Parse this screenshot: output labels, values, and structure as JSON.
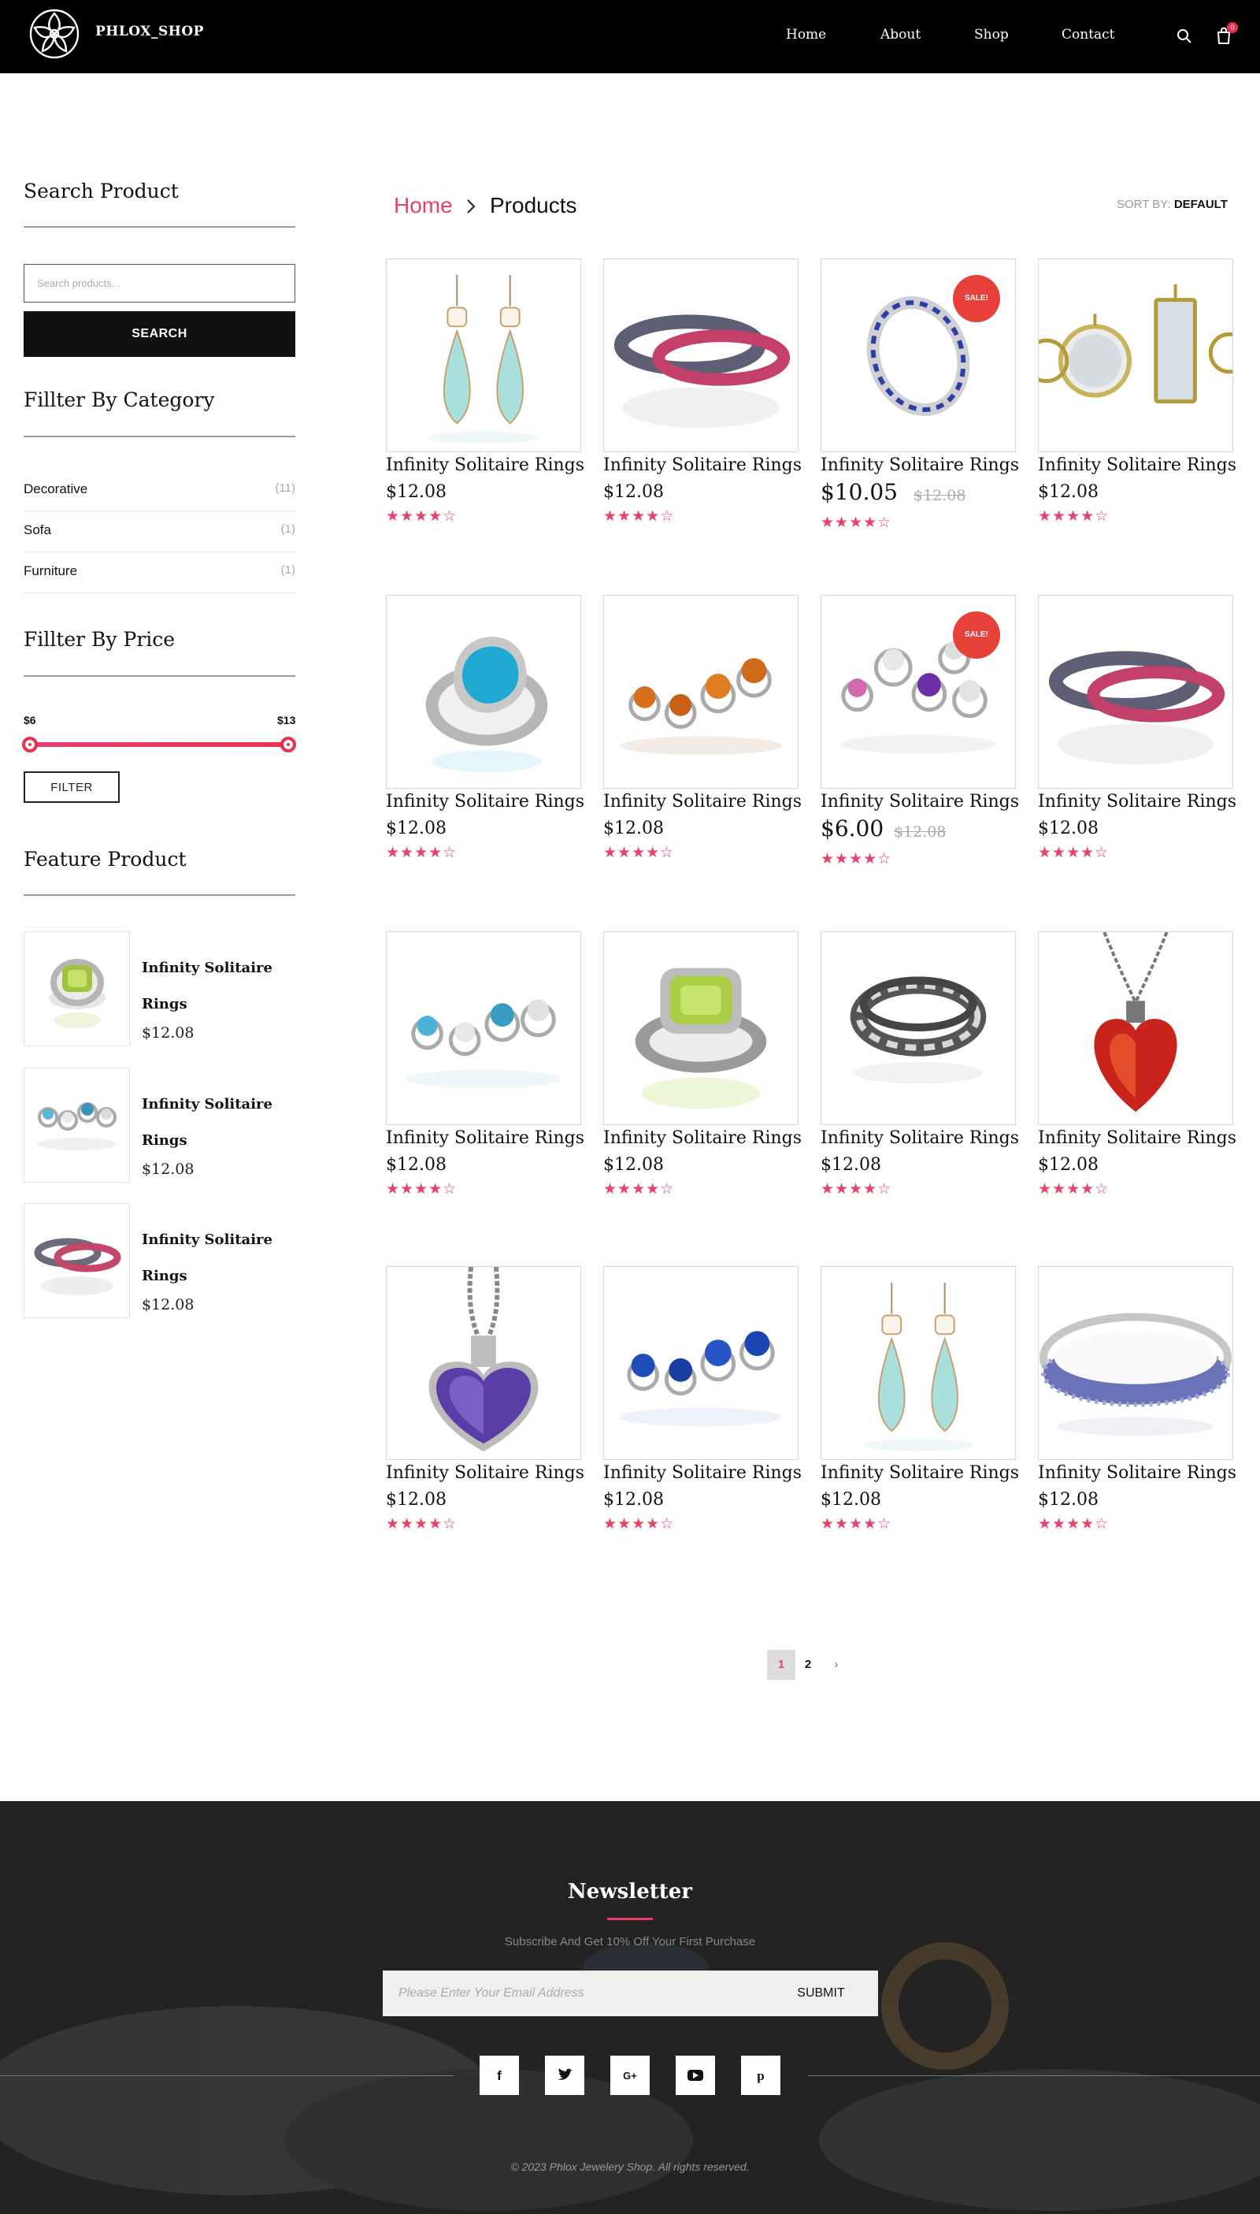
{
  "header": {
    "brand": "PHLOX_SHOP",
    "nav": [
      "Home",
      "About",
      "Shop",
      "Contact"
    ],
    "cart_count": "0",
    "icons": [
      "logo-flower-icon",
      "search-icon",
      "cart-icon"
    ]
  },
  "sidebar": {
    "search_title": "Search Product",
    "search_placeholder": "Search products...",
    "search_button": "SEARCH",
    "category_title": "Fillter By Category",
    "categories": [
      {
        "name": "Decorative",
        "count": "(11)"
      },
      {
        "name": "Sofa",
        "count": "(1)"
      },
      {
        "name": "Furniture",
        "count": "(1)"
      }
    ],
    "price_title": "Fillter By Price",
    "price_min": "$6",
    "price_max": "$13",
    "range_selected": [
      0,
      1
    ],
    "filter_button": "FILTER",
    "feature_title": "Feature Product",
    "features": [
      {
        "name": "Infinity Solitaire Rings",
        "price": "$12.08"
      },
      {
        "name": "Infinity Solitaire Rings",
        "price": "$12.08"
      },
      {
        "name": "Infinity Solitaire Rings",
        "price": "$12.08"
      }
    ]
  },
  "main": {
    "breadcrumb_home": "Home",
    "breadcrumb_current": "Products",
    "sort_label": "SORT BY:",
    "sort_value": "DEFAULT",
    "stars": "★★★★☆",
    "products": [
      {
        "name": "Infinity Solitaire Rings",
        "price": "$12.08",
        "image": "earrings"
      },
      {
        "name": "Infinity Solitaire Rings",
        "price": "$12.08",
        "image": "band-rings"
      },
      {
        "name": "Infinity Solitaire Rings",
        "price": "$10.05",
        "old_price": "$12.08",
        "sale": "SALE!",
        "image": "sapphire-ring"
      },
      {
        "name": "Infinity Solitaire Rings",
        "price": "$12.08",
        "image": "pendants"
      },
      {
        "name": "Infinity Solitaire Rings",
        "price": "$12.08",
        "image": "turquoise-ring"
      },
      {
        "name": "Infinity Solitaire Rings",
        "price": "$12.08",
        "image": "amber-rings"
      },
      {
        "name": "Infinity Solitaire Rings",
        "price": "$6.00",
        "old_price": "$12.08",
        "sale": "SALE!",
        "image": "cluster-rings"
      },
      {
        "name": "Infinity Solitaire Rings",
        "price": "$12.08",
        "image": "band-rings"
      },
      {
        "name": "Infinity Solitaire Rings",
        "price": "$12.08",
        "image": "blue-topaz-rings"
      },
      {
        "name": "Infinity Solitaire Rings",
        "price": "$12.08",
        "image": "peridot-ring"
      },
      {
        "name": "Infinity Solitaire Rings",
        "price": "$12.08",
        "image": "woven-band"
      },
      {
        "name": "Infinity Solitaire Rings",
        "price": "$12.08",
        "image": "ruby-heart"
      },
      {
        "name": "Infinity Solitaire Rings",
        "price": "$12.08",
        "image": "amethyst-heart"
      },
      {
        "name": "Infinity Solitaire Rings",
        "price": "$12.08",
        "image": "sapphire-rings"
      },
      {
        "name": "Infinity Solitaire Rings",
        "price": "$12.08",
        "image": "earrings"
      },
      {
        "name": "Infinity Solitaire Rings",
        "price": "$12.08",
        "image": "bangle"
      }
    ],
    "pages": [
      "1",
      "2",
      "›"
    ]
  },
  "footer": {
    "title": "Newsletter",
    "subtitle": "Subscribe And Get 10% Off Your First Purchase",
    "email_placeholder": "Please Enter Your Email Address",
    "submit": "SUBMIT",
    "social": [
      "f",
      "t",
      "G+",
      "yt",
      "p"
    ],
    "copyright": "© 2023 Phlox Jewelery Shop. All rights reserved."
  },
  "colors": {
    "accent": "#e8416a",
    "sale": "#e8413a",
    "header": "#000000",
    "footer": "#232323"
  }
}
